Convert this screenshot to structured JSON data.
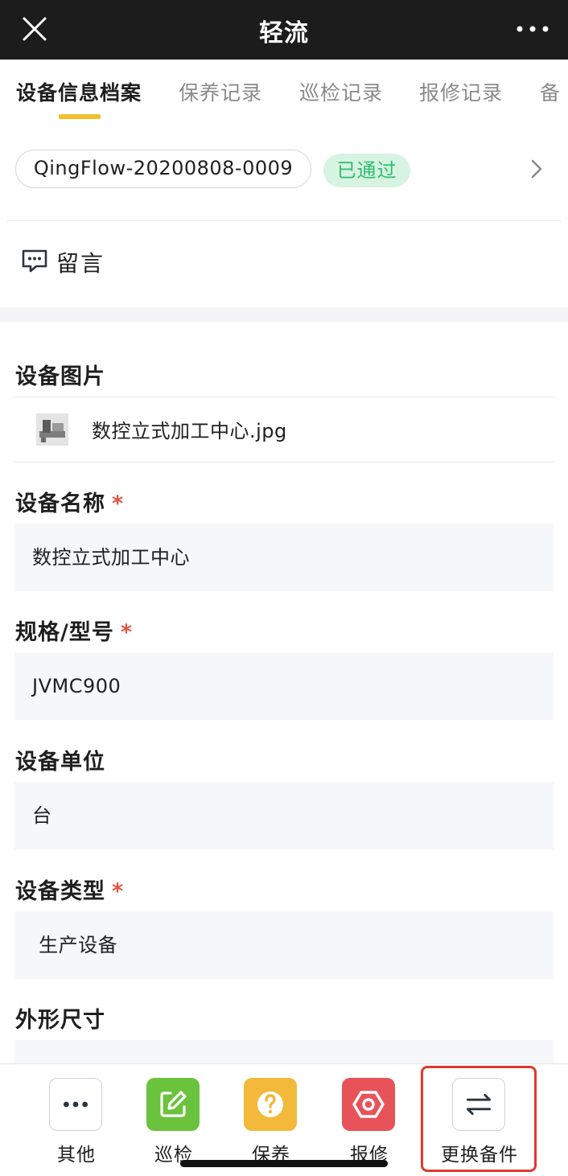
{
  "app": {
    "title": "轻流"
  },
  "tabs": [
    {
      "label": "设备信息档案",
      "active": true
    },
    {
      "label": "保养记录",
      "active": false
    },
    {
      "label": "巡检记录",
      "active": false
    },
    {
      "label": "报修记录",
      "active": false
    },
    {
      "label": "备",
      "active": false
    }
  ],
  "record": {
    "id": "QingFlow-20200808-0009",
    "status": "已通过"
  },
  "comment": {
    "label": "留言"
  },
  "form": {
    "image": {
      "label": "设备图片",
      "file_name": "数控立式加工中心.jpg"
    },
    "name": {
      "label": "设备名称",
      "required": "*",
      "value": "数控立式加工中心"
    },
    "model": {
      "label": "规格/型号",
      "required": "*",
      "value": "JVMC900"
    },
    "unit": {
      "label": "设备单位",
      "value": "台"
    },
    "type": {
      "label": "设备类型",
      "required": "*",
      "value": " 生产设备"
    },
    "size": {
      "label": "外形尺寸",
      "value": ""
    }
  },
  "actions": [
    {
      "label": "其他",
      "icon": "more-icon"
    },
    {
      "label": "巡检",
      "icon": "edit-icon"
    },
    {
      "label": "保养",
      "icon": "question-icon"
    },
    {
      "label": "报修",
      "icon": "hex-nut-icon"
    },
    {
      "label": "更换备件",
      "icon": "swap-icon"
    }
  ],
  "colors": {
    "accent": "#f2bf2b",
    "status_green": "#2fbf6d",
    "required_red": "#e2553d",
    "highlight_red": "#e03a2e"
  }
}
